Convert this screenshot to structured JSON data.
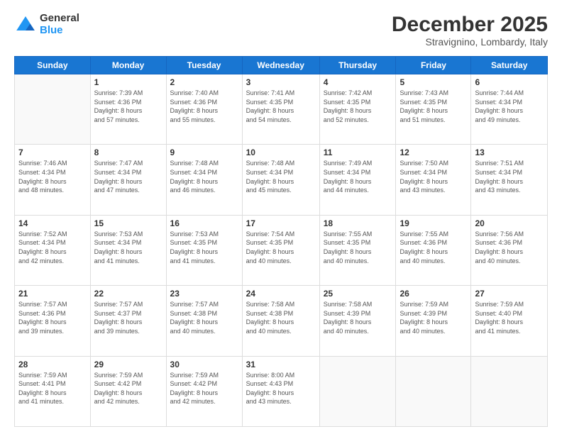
{
  "logo": {
    "general": "General",
    "blue": "Blue"
  },
  "header": {
    "month": "December 2025",
    "location": "Stravignino, Lombardy, Italy"
  },
  "weekdays": [
    "Sunday",
    "Monday",
    "Tuesday",
    "Wednesday",
    "Thursday",
    "Friday",
    "Saturday"
  ],
  "weeks": [
    [
      {
        "day": "",
        "info": ""
      },
      {
        "day": "1",
        "info": "Sunrise: 7:39 AM\nSunset: 4:36 PM\nDaylight: 8 hours\nand 57 minutes."
      },
      {
        "day": "2",
        "info": "Sunrise: 7:40 AM\nSunset: 4:36 PM\nDaylight: 8 hours\nand 55 minutes."
      },
      {
        "day": "3",
        "info": "Sunrise: 7:41 AM\nSunset: 4:35 PM\nDaylight: 8 hours\nand 54 minutes."
      },
      {
        "day": "4",
        "info": "Sunrise: 7:42 AM\nSunset: 4:35 PM\nDaylight: 8 hours\nand 52 minutes."
      },
      {
        "day": "5",
        "info": "Sunrise: 7:43 AM\nSunset: 4:35 PM\nDaylight: 8 hours\nand 51 minutes."
      },
      {
        "day": "6",
        "info": "Sunrise: 7:44 AM\nSunset: 4:34 PM\nDaylight: 8 hours\nand 49 minutes."
      }
    ],
    [
      {
        "day": "7",
        "info": "Sunrise: 7:46 AM\nSunset: 4:34 PM\nDaylight: 8 hours\nand 48 minutes."
      },
      {
        "day": "8",
        "info": "Sunrise: 7:47 AM\nSunset: 4:34 PM\nDaylight: 8 hours\nand 47 minutes."
      },
      {
        "day": "9",
        "info": "Sunrise: 7:48 AM\nSunset: 4:34 PM\nDaylight: 8 hours\nand 46 minutes."
      },
      {
        "day": "10",
        "info": "Sunrise: 7:48 AM\nSunset: 4:34 PM\nDaylight: 8 hours\nand 45 minutes."
      },
      {
        "day": "11",
        "info": "Sunrise: 7:49 AM\nSunset: 4:34 PM\nDaylight: 8 hours\nand 44 minutes."
      },
      {
        "day": "12",
        "info": "Sunrise: 7:50 AM\nSunset: 4:34 PM\nDaylight: 8 hours\nand 43 minutes."
      },
      {
        "day": "13",
        "info": "Sunrise: 7:51 AM\nSunset: 4:34 PM\nDaylight: 8 hours\nand 43 minutes."
      }
    ],
    [
      {
        "day": "14",
        "info": "Sunrise: 7:52 AM\nSunset: 4:34 PM\nDaylight: 8 hours\nand 42 minutes."
      },
      {
        "day": "15",
        "info": "Sunrise: 7:53 AM\nSunset: 4:34 PM\nDaylight: 8 hours\nand 41 minutes."
      },
      {
        "day": "16",
        "info": "Sunrise: 7:53 AM\nSunset: 4:35 PM\nDaylight: 8 hours\nand 41 minutes."
      },
      {
        "day": "17",
        "info": "Sunrise: 7:54 AM\nSunset: 4:35 PM\nDaylight: 8 hours\nand 40 minutes."
      },
      {
        "day": "18",
        "info": "Sunrise: 7:55 AM\nSunset: 4:35 PM\nDaylight: 8 hours\nand 40 minutes."
      },
      {
        "day": "19",
        "info": "Sunrise: 7:55 AM\nSunset: 4:36 PM\nDaylight: 8 hours\nand 40 minutes."
      },
      {
        "day": "20",
        "info": "Sunrise: 7:56 AM\nSunset: 4:36 PM\nDaylight: 8 hours\nand 40 minutes."
      }
    ],
    [
      {
        "day": "21",
        "info": "Sunrise: 7:57 AM\nSunset: 4:36 PM\nDaylight: 8 hours\nand 39 minutes."
      },
      {
        "day": "22",
        "info": "Sunrise: 7:57 AM\nSunset: 4:37 PM\nDaylight: 8 hours\nand 39 minutes."
      },
      {
        "day": "23",
        "info": "Sunrise: 7:57 AM\nSunset: 4:38 PM\nDaylight: 8 hours\nand 40 minutes."
      },
      {
        "day": "24",
        "info": "Sunrise: 7:58 AM\nSunset: 4:38 PM\nDaylight: 8 hours\nand 40 minutes."
      },
      {
        "day": "25",
        "info": "Sunrise: 7:58 AM\nSunset: 4:39 PM\nDaylight: 8 hours\nand 40 minutes."
      },
      {
        "day": "26",
        "info": "Sunrise: 7:59 AM\nSunset: 4:39 PM\nDaylight: 8 hours\nand 40 minutes."
      },
      {
        "day": "27",
        "info": "Sunrise: 7:59 AM\nSunset: 4:40 PM\nDaylight: 8 hours\nand 41 minutes."
      }
    ],
    [
      {
        "day": "28",
        "info": "Sunrise: 7:59 AM\nSunset: 4:41 PM\nDaylight: 8 hours\nand 41 minutes."
      },
      {
        "day": "29",
        "info": "Sunrise: 7:59 AM\nSunset: 4:42 PM\nDaylight: 8 hours\nand 42 minutes."
      },
      {
        "day": "30",
        "info": "Sunrise: 7:59 AM\nSunset: 4:42 PM\nDaylight: 8 hours\nand 42 minutes."
      },
      {
        "day": "31",
        "info": "Sunrise: 8:00 AM\nSunset: 4:43 PM\nDaylight: 8 hours\nand 43 minutes."
      },
      {
        "day": "",
        "info": ""
      },
      {
        "day": "",
        "info": ""
      },
      {
        "day": "",
        "info": ""
      }
    ]
  ]
}
